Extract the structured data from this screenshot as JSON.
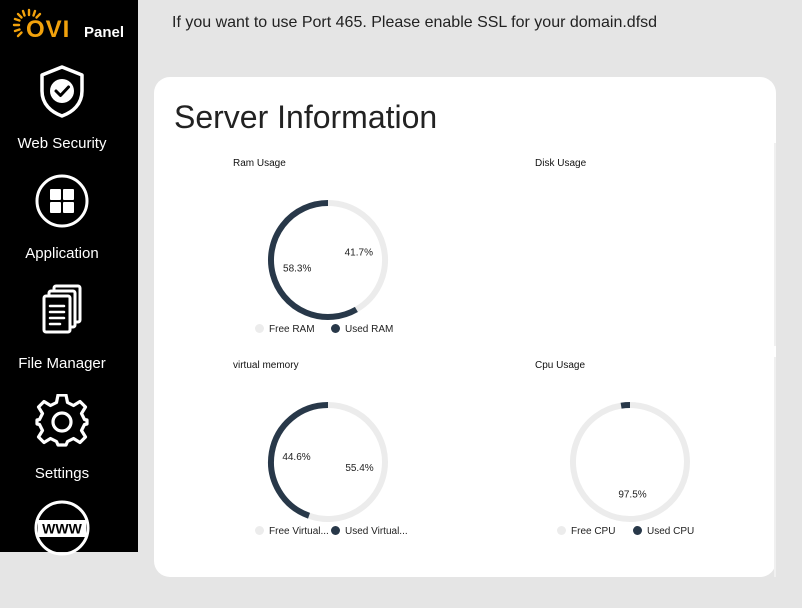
{
  "brand": {
    "logo_ovi": "OVI",
    "logo_panel": "Panel"
  },
  "sidebar": {
    "items": [
      {
        "label": "Web Security",
        "icon": "shield-check-icon"
      },
      {
        "label": "Application",
        "icon": "grid-icon"
      },
      {
        "label": "File Manager",
        "icon": "documents-icon"
      },
      {
        "label": "Settings",
        "icon": "gear-icon"
      },
      {
        "label": "",
        "icon": "www-icon",
        "icon_text": "WWW"
      }
    ]
  },
  "notice": "If you want to use Port 465. Please enable SSL for your domain.dfsd",
  "main": {
    "title": "Server Information"
  },
  "colors": {
    "used": "#283849",
    "free": "#ececec",
    "accent": "#f2a20c"
  },
  "chart_data": [
    {
      "type": "pie",
      "title": "Ram Usage",
      "series": [
        {
          "name": "Free RAM",
          "value": 41.7,
          "label": "41.7%"
        },
        {
          "name": "Used RAM",
          "value": 58.3,
          "label": "58.3%"
        }
      ]
    },
    {
      "type": "pie",
      "title": "Disk Usage",
      "series": []
    },
    {
      "type": "pie",
      "title": "virtual memory",
      "series": [
        {
          "name": "Free Virtual...",
          "value": 55.4,
          "label": "55.4%"
        },
        {
          "name": "Used Virtual...",
          "value": 44.6,
          "label": "44.6%"
        }
      ]
    },
    {
      "type": "pie",
      "title": "Cpu Usage",
      "series": [
        {
          "name": "Free CPU",
          "value": 97.5,
          "label": "97.5%"
        },
        {
          "name": "Used CPU",
          "value": 2.5,
          "label": ""
        }
      ]
    }
  ]
}
